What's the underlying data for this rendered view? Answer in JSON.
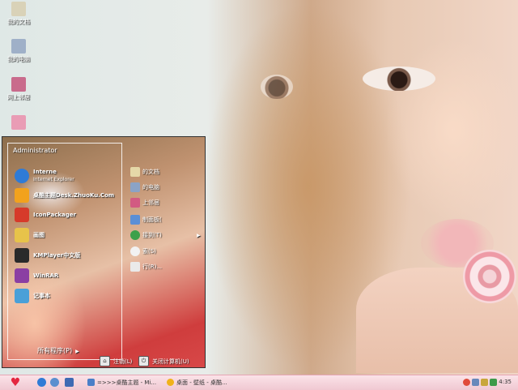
{
  "desktop": {
    "icons": [
      {
        "label": "我的文档",
        "icon": "my-documents-icon",
        "color": "#d9d2b8"
      },
      {
        "label": "我的电脑",
        "icon": "my-computer-icon",
        "color": "#9fb0c8"
      },
      {
        "label": "网上邻居",
        "icon": "network-places-icon",
        "color": "#c96b8c"
      },
      {
        "label": "",
        "icon": "recycle-bin-icon",
        "color": "#e99cb5"
      }
    ]
  },
  "start_menu": {
    "user": "Administrator",
    "pinned": [
      {
        "label": "Interne",
        "sub": "Internet Explorer",
        "icon": "internet-explorer-icon",
        "color": "#2f7bd6"
      },
      {
        "label": "桌酷主题Desk.ZhuoKu.Com",
        "sub": "",
        "icon": "zhuoku-theme-icon",
        "color": "#f2a21d"
      },
      {
        "label": "IconPackager",
        "sub": "",
        "icon": "iconpackager-icon",
        "color": "#d63a2a"
      }
    ],
    "recent": [
      {
        "label": "画图",
        "icon": "paint-icon",
        "color": "#e7c34a"
      },
      {
        "label": "KMPlayer中文版",
        "icon": "kmplayer-icon",
        "color": "#2a2a2a"
      },
      {
        "label": "WinRAR",
        "icon": "winrar-icon",
        "color": "#8b3fa3"
      },
      {
        "label": "记事本",
        "icon": "notepad-icon",
        "color": "#4aa0d8"
      }
    ],
    "all_programs": "所有程序(P)",
    "places": [
      {
        "label": "的文档",
        "icon": "my-documents-icon",
        "color": "#e5d8a8",
        "arrow": false
      },
      {
        "label": "的电脑",
        "icon": "my-computer-icon",
        "color": "#8ba3c6",
        "arrow": false
      },
      {
        "label": "上邻居",
        "icon": "network-places-icon",
        "color": "#d25b82",
        "arrow": false
      },
      {
        "label": "制面板(",
        "icon": "control-panel-icon",
        "color": "#5b8fd6",
        "arrow": false
      },
      {
        "label": "接到(T)",
        "icon": "connect-to-icon",
        "color": "#3da04a",
        "arrow": true
      },
      {
        "label": "索(S)",
        "icon": "search-icon",
        "color": "#f2f2f2",
        "arrow": false
      },
      {
        "label": "行(R)...",
        "icon": "run-icon",
        "color": "#eaeaea",
        "arrow": false
      }
    ],
    "logoff": "注销(L)",
    "shutdown": "关闭计算机(U)"
  },
  "taskbar": {
    "tasks": [
      {
        "label": "=>>>桌酷主题 - Mi...",
        "icon": "folder-window-icon",
        "color": "#4a7fc8"
      },
      {
        "label": "桌面 - 壁纸 - 桌酷...",
        "icon": "browser-window-icon",
        "color": "#f0b21a"
      }
    ],
    "quick_launch": [
      {
        "icon": "ie-quicklaunch-icon",
        "color": "#2f7bd6"
      },
      {
        "icon": "media-quicklaunch-icon",
        "color": "#5a8fcf"
      },
      {
        "icon": "desktop-quicklaunch-icon",
        "color": "#3e6ab3"
      }
    ],
    "tray": [
      {
        "icon": "qq-tray-icon",
        "color": "#e04a3a"
      },
      {
        "icon": "network-tray-icon",
        "color": "#6688bb"
      },
      {
        "icon": "volume-tray-icon",
        "color": "#c8a63a"
      },
      {
        "icon": "security-tray-icon",
        "color": "#3c9a4a"
      }
    ],
    "clock": "4:35"
  }
}
